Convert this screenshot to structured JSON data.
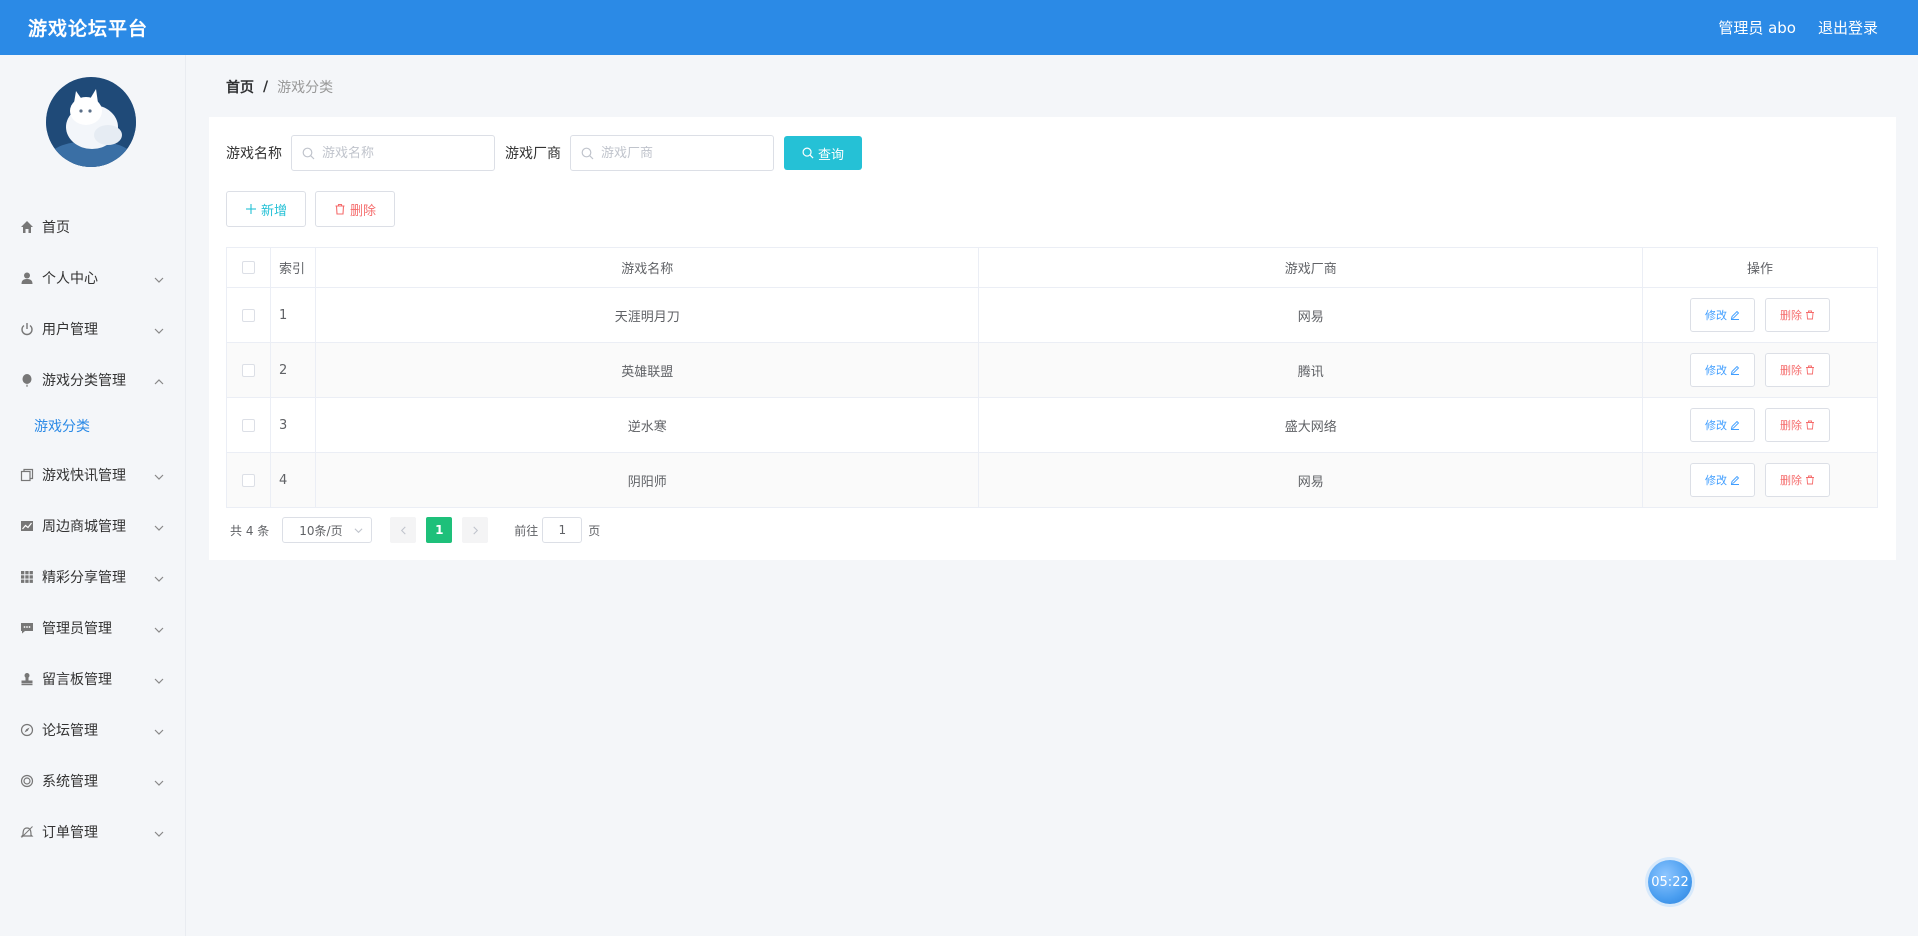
{
  "header": {
    "logo": "游戏论坛平台",
    "user_label": "管理员 abo",
    "logout_label": "退出登录"
  },
  "sidebar": {
    "items": [
      {
        "label": "首页",
        "icon": "home-icon"
      },
      {
        "label": "个人中心",
        "icon": "user-icon"
      },
      {
        "label": "用户管理",
        "icon": "power-icon"
      },
      {
        "label": "游戏分类管理",
        "icon": "balloon-icon"
      },
      {
        "label": "游戏快讯管理",
        "icon": "copy-icon"
      },
      {
        "label": "周边商城管理",
        "icon": "chart-icon"
      },
      {
        "label": "精彩分享管理",
        "icon": "grid-icon"
      },
      {
        "label": "管理员管理",
        "icon": "chat-icon"
      },
      {
        "label": "留言板管理",
        "icon": "stamp-icon"
      },
      {
        "label": "论坛管理",
        "icon": "compass-icon"
      },
      {
        "label": "系统管理",
        "icon": "circle-icon"
      },
      {
        "label": "订单管理",
        "icon": "bell-icon"
      }
    ],
    "subitem": "游戏分类"
  },
  "breadcrumb": {
    "home": "首页",
    "separator": "/",
    "current": "游戏分类"
  },
  "search": {
    "name_label": "游戏名称",
    "name_placeholder": "游戏名称",
    "vendor_label": "游戏厂商",
    "vendor_placeholder": "游戏厂商",
    "button_label": "查询"
  },
  "actions": {
    "add_label": "新增",
    "delete_label": "删除"
  },
  "table": {
    "headers": {
      "index": "索引",
      "name": "游戏名称",
      "vendor": "游戏厂商",
      "ops": "操作"
    },
    "rows": [
      {
        "index": "1",
        "name": "天涯明月刀",
        "vendor": "网易"
      },
      {
        "index": "2",
        "name": "英雄联盟",
        "vendor": "腾讯"
      },
      {
        "index": "3",
        "name": "逆水寒",
        "vendor": "盛大网络"
      },
      {
        "index": "4",
        "name": "阴阳师",
        "vendor": "网易"
      }
    ],
    "edit_label": "修改",
    "delete_label": "删除"
  },
  "pagination": {
    "total": "共 4 条",
    "page_size": "10条/页",
    "current_page": "1",
    "goto_label": "前往",
    "goto_value": "1",
    "page_suffix": "页"
  },
  "time_badge": "05:22",
  "colors": {
    "header_bg": "#2b8ae6",
    "search_button": "#25c1d6",
    "active_page": "#1ec07a",
    "danger": "#f56c6c"
  }
}
